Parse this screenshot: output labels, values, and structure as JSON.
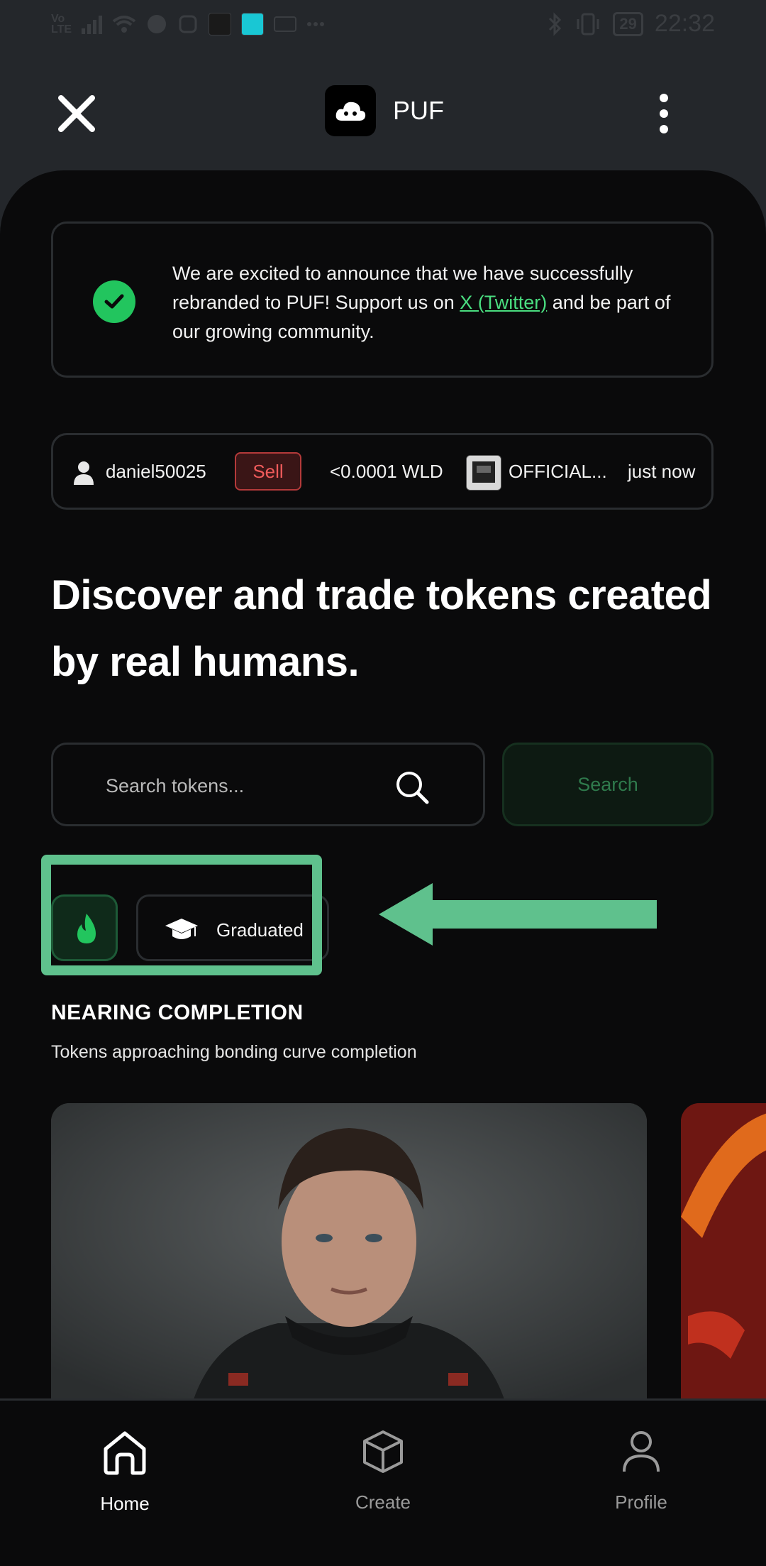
{
  "status_bar": {
    "network_label": "Vo\nLTE",
    "battery": "29",
    "time": "22:32"
  },
  "header": {
    "app_name": "PUF"
  },
  "announcement": {
    "text_before": "We are excited to announce that we have successfully rebranded to PUF! Support us on ",
    "link_text": "X (Twitter)",
    "text_after": " and be part of our growing community."
  },
  "ticker": {
    "user": "daniel50025",
    "action": "Sell",
    "amount": "<0.0001 WLD",
    "token": "OFFICIAL...",
    "time": "just now"
  },
  "hero": {
    "headline": "Discover and trade tokens created by real humans."
  },
  "search": {
    "placeholder": "Search tokens...",
    "button_label": "Search"
  },
  "filters": {
    "graduated_label": "Graduated"
  },
  "section": {
    "title": "NEARING COMPLETION",
    "subtitle": "Tokens approaching bonding curve completion"
  },
  "bottom_nav": {
    "items": [
      {
        "label": "Home",
        "icon": "home-icon",
        "active": true
      },
      {
        "label": "Create",
        "icon": "box-icon",
        "active": false
      },
      {
        "label": "Profile",
        "icon": "user-icon",
        "active": false
      }
    ]
  },
  "colors": {
    "accent_green": "#22c55e",
    "annotation_green": "#5fc18d",
    "sell_red": "#ef5b5b",
    "background": "#0a0a0b"
  }
}
